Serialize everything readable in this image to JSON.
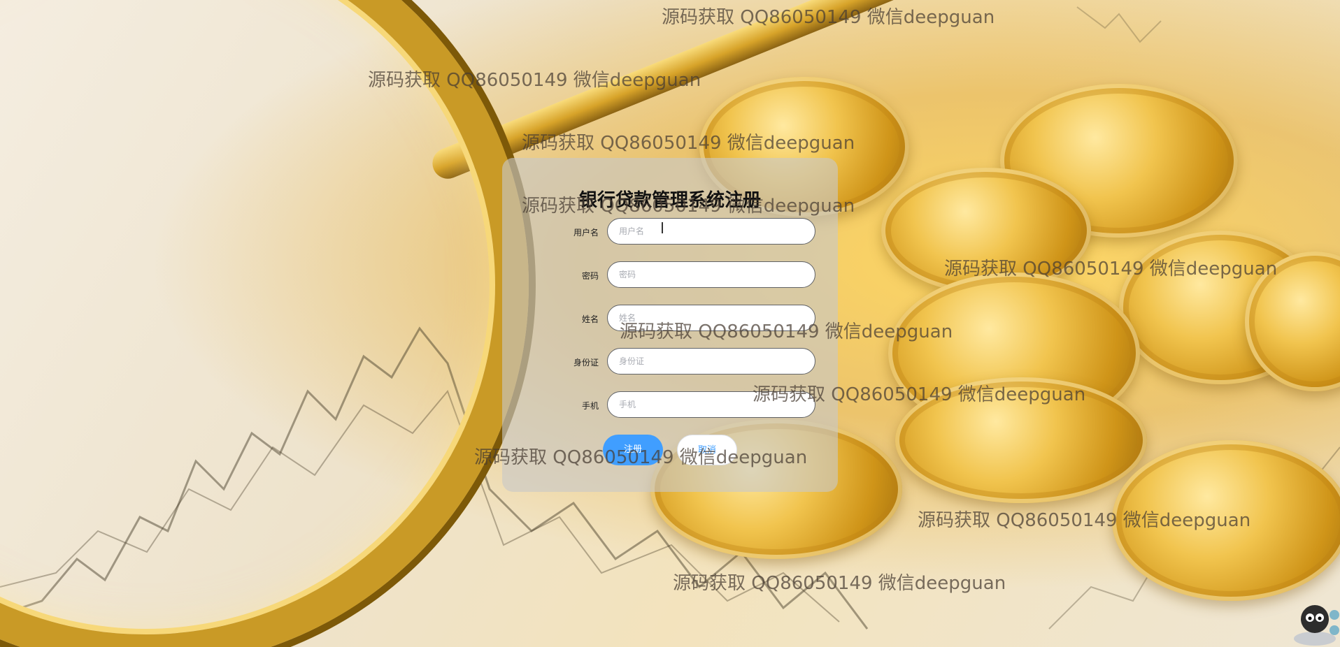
{
  "form": {
    "title": "银行贷款管理系统注册",
    "fields": [
      {
        "label": "用户名",
        "placeholder": "用户名",
        "value": ""
      },
      {
        "label": "密码",
        "placeholder": "密码",
        "value": ""
      },
      {
        "label": "姓名",
        "placeholder": "姓名",
        "value": ""
      },
      {
        "label": "身份证",
        "placeholder": "身份证",
        "value": ""
      },
      {
        "label": "手机",
        "placeholder": "手机",
        "value": ""
      }
    ],
    "register_label": "注册",
    "cancel_label": "取消"
  },
  "watermark": {
    "text": "源码获取 QQ86050149 微信deepguan"
  },
  "colors": {
    "primary": "#409eff",
    "card_bg": "rgba(200,200,200,0.62)",
    "input_border": "#606266"
  }
}
